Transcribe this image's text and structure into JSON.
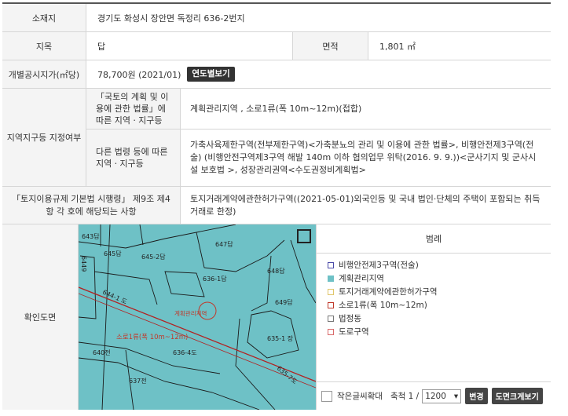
{
  "rows": {
    "address": {
      "label": "소재지",
      "value": "경기도 화성시 장안면 독정리 636-2번지"
    },
    "landcat": {
      "label": "지목",
      "value": "답",
      "area_label": "면적",
      "area_value": "1,801 ㎡"
    },
    "price": {
      "label": "개별공시지가(㎡당)",
      "value": "78,700원 (2021/01)",
      "button": "연도별보기"
    }
  },
  "zoning": {
    "label": "지역지구등 지정여부",
    "sub1": {
      "label": "「국토의 계획 및 이용에 관한 법률」에 따른 지역ㆍ지구등",
      "value": "계획관리지역 , 소로1류(폭 10m~12m)(접합)"
    },
    "sub2": {
      "label": "다른 법령 등에 따른 지역ㆍ지구등",
      "value": "가축사육제한구역(전부제한구역)<가축분뇨의 관리 및 이용에 관한 법률>, 비행안전제3구역(전술) (비행안전구역제3구역 해발 140m 이하 협의업무 위탁(2016. 9. 9.))<군사기지 및 군사시설 보호법 >, 성장관리권역<수도권정비계획법>"
    }
  },
  "regulation": {
    "label": "「토지이용규제 기본법 시행령」 제9조 제4항 각 호에 해당되는 사항",
    "value": "토지거래계약에관한허가구역((2021-05-01)외국인등 및 국내 법인·단체의 주택이 포함되는 취득 거래로 한정)"
  },
  "map": {
    "label": "확인도면",
    "parcels": [
      "643답",
      "645답",
      "645-2답",
      "647답",
      "644-1 도",
      "636-1답",
      "648답",
      "649답",
      "636-2답",
      "635-1 장",
      "640전",
      "636-4도",
      "637전",
      "635-7도",
      "6449"
    ],
    "road_label": "소로1류(폭 10m~12m)",
    "zone_label": "계획관리지역"
  },
  "legend": {
    "title": "범례",
    "items": [
      {
        "label": "비행안전제3구역(전술)",
        "color": "#4a4aa8"
      },
      {
        "label": "계획관리지역",
        "color": "#6ec1c6"
      },
      {
        "label": "토지거래계약에관한허가구역",
        "color": "#e0c66a"
      },
      {
        "label": "소로1류(폭 10m~12m)",
        "color": "#c0392b"
      },
      {
        "label": "법정동",
        "color": "#777"
      },
      {
        "label": "도로구역",
        "color": "#d96a6a"
      }
    ]
  },
  "controls": {
    "zoom_text": "작은글씨확대",
    "scale_label": "축척 1 /",
    "scale_value": "1200",
    "change_button": "변경",
    "print_button": "도면크게보기"
  }
}
